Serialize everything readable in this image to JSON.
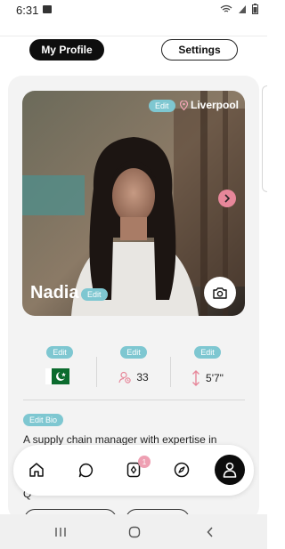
{
  "status_bar": {
    "time": "6:31",
    "signal_text": "◔ ⟋ ▮"
  },
  "tabs": {
    "my_profile": "My Profile",
    "settings": "Settings"
  },
  "profile": {
    "location_edit": "Edit",
    "location": "Liverpool",
    "name": "Nadia",
    "name_edit": "Edit"
  },
  "stats": [
    {
      "edit": "Edit",
      "value": "",
      "icon": "pakistan-flag-icon"
    },
    {
      "edit": "Edit",
      "value": "33",
      "icon": "age-icon"
    },
    {
      "edit": "Edit",
      "value": "5'7\"",
      "icon": "height-icon"
    }
  ],
  "bio": {
    "edit": "Edit Bio",
    "text": "A supply chain manager with expertise in",
    "trailing": "Q"
  },
  "nav": {
    "badge_count": "1"
  },
  "colors": {
    "accent": "#7ec7d1",
    "pink": "#e7879a",
    "dark": "#0e0e0e"
  }
}
